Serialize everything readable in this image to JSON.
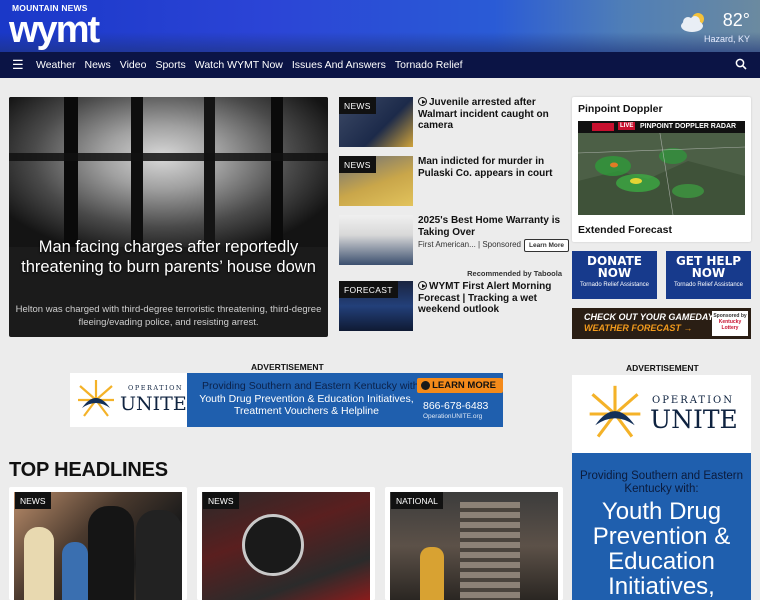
{
  "header": {
    "brand_top": "MOUNTAIN NEWS",
    "brand_call": "wymt",
    "weather": {
      "temp": "82°",
      "location": "Hazard, KY",
      "icon": "partly-cloudy-icon"
    }
  },
  "nav": {
    "items": [
      "Weather",
      "News",
      "Video",
      "Sports",
      "Watch WYMT Now",
      "Issues And Answers",
      "Tornado Relief"
    ]
  },
  "feature": {
    "headline": "Man facing charges after reportedly threatening to burn parents’ house down",
    "summary": "Helton was charged with third-degree terroristic threatening, third-degree fleeing/evading police, and resisting arrest."
  },
  "stories": [
    {
      "tag": "NEWS",
      "title": "Juvenile arrested after Walmart incident caught on camera",
      "video": true
    },
    {
      "tag": "NEWS",
      "title": "Man indicted for murder in Pulaski Co. appears in court",
      "video": false
    },
    {
      "tag": "",
      "title": "2025's Best Home Warranty is Taking Over",
      "meta": "First American... | Sponsored",
      "cta": "Learn More",
      "video": false
    },
    {
      "tag": "FORECAST",
      "title": "WYMT First Alert Morning Forecast | Tracking a wet weekend outlook",
      "video": true
    }
  ],
  "taboola": "Recommended by Taboola",
  "sidebar": {
    "doppler_title": "Pinpoint Doppler",
    "radar_label": "PINPOINT DOPPLER RADAR",
    "live_label": "LIVE",
    "extended_label": "Extended Forecast",
    "donate": {
      "title": "DONATE NOW",
      "sub": "Tornado Relief Assistance"
    },
    "help": {
      "title": "GET HELP NOW",
      "sub": "Tornado Relief Assistance"
    },
    "gameday": {
      "line1": "CHECK OUT YOUR GAMEDAY",
      "line2": "WEATHER FORECAST →",
      "sponsor": "Sponsored by",
      "sponsor_name": "Kentucky Lottery"
    }
  },
  "ads": {
    "label": "ADVERTISEMENT",
    "brand_small": "OPERATION",
    "brand_big": "UNITE",
    "line1": "Providing Southern and Eastern Kentucky with:",
    "line2": "Youth Drug Prevention & Education Initiatives, Treatment Vouchers & Helpline",
    "cta": "LEARN MORE",
    "phone": "866-678-6483",
    "url": "OperationUNITE.org",
    "side_line1": "Providing Southern and Eastern Kentucky with:",
    "side_line2": "Youth Drug Prevention & Education Initiatives,"
  },
  "top_headlines": {
    "title": "TOP HEADLINES",
    "cards": [
      {
        "tag": "NEWS"
      },
      {
        "tag": "NEWS"
      },
      {
        "tag": "NATIONAL"
      }
    ]
  },
  "colors": {
    "header_blue": "#1a38c8",
    "nav_navy": "#0b1445",
    "ad_blue": "#1f5fae",
    "ad_orange": "#f48a1a"
  }
}
